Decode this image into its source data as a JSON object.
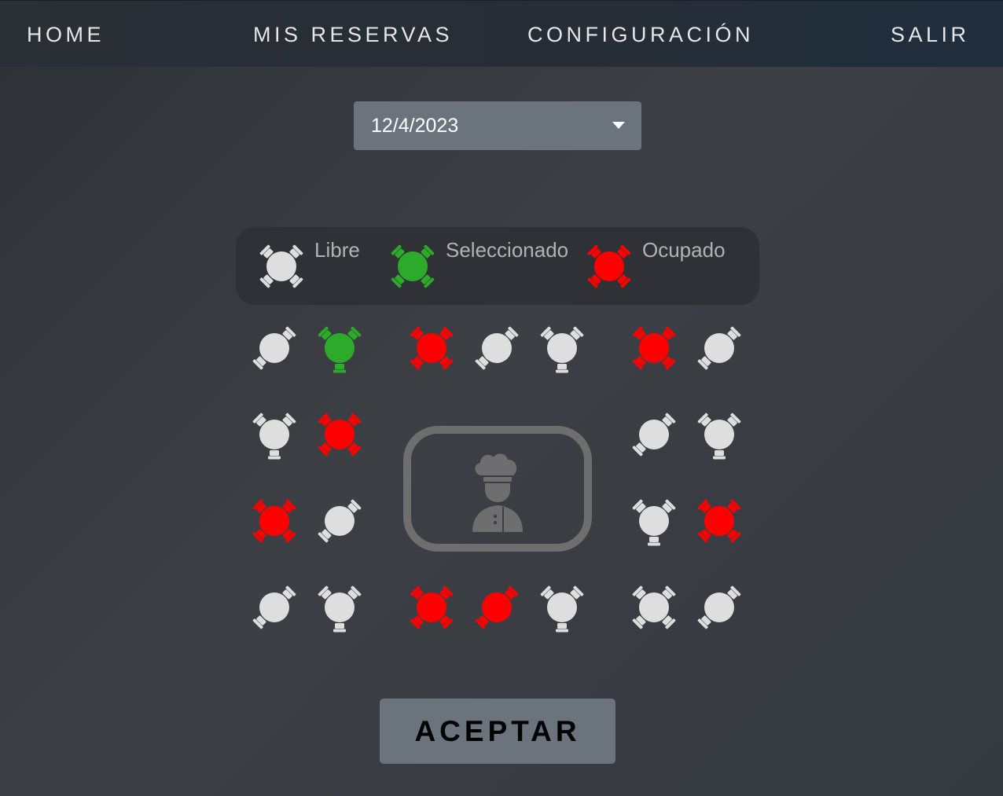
{
  "nav": {
    "home": "HOME",
    "reservations": "MIS RESERVAS",
    "settings": "CONFIGURACIÓN",
    "logout": "SALIR"
  },
  "date_picker": {
    "value": "12/4/2023"
  },
  "legend": {
    "free": "Libre",
    "selected": "Seleccionado",
    "occupied": "Ocupado"
  },
  "colors": {
    "free": "#dedede",
    "selected": "#2eaa2a",
    "occupied": "#ff0000",
    "kitchen": "#6e6e6e"
  },
  "seats": [
    {
      "state": "free",
      "chairs": "2d"
    },
    {
      "state": "selected",
      "chairs": "3"
    },
    {
      "state": "occupied",
      "chairs": "4"
    },
    {
      "state": "free",
      "chairs": "2d"
    },
    {
      "state": "free",
      "chairs": "3"
    },
    {
      "state": "occupied",
      "chairs": "4"
    },
    {
      "state": "free",
      "chairs": "2d"
    },
    {
      "state": "free",
      "chairs": "3"
    },
    {
      "state": "occupied",
      "chairs": "4"
    },
    {
      "state": "free",
      "chairs": "2d"
    },
    {
      "state": "free",
      "chairs": "3"
    },
    {
      "state": "occupied",
      "chairs": "4"
    },
    {
      "state": "free",
      "chairs": "2d"
    },
    {
      "state": "free",
      "chairs": "3"
    },
    {
      "state": "occupied",
      "chairs": "4"
    },
    {
      "state": "free",
      "chairs": "2d"
    },
    {
      "state": "free",
      "chairs": "3"
    },
    {
      "state": "occupied",
      "chairs": "4"
    },
    {
      "state": "occupied",
      "chairs": "2d"
    },
    {
      "state": "free",
      "chairs": "3"
    },
    {
      "state": "free",
      "chairs": "4"
    },
    {
      "state": "free",
      "chairs": "2d"
    }
  ],
  "kitchen": {
    "icon": "chef-icon"
  },
  "accept_button": "ACEPTAR"
}
